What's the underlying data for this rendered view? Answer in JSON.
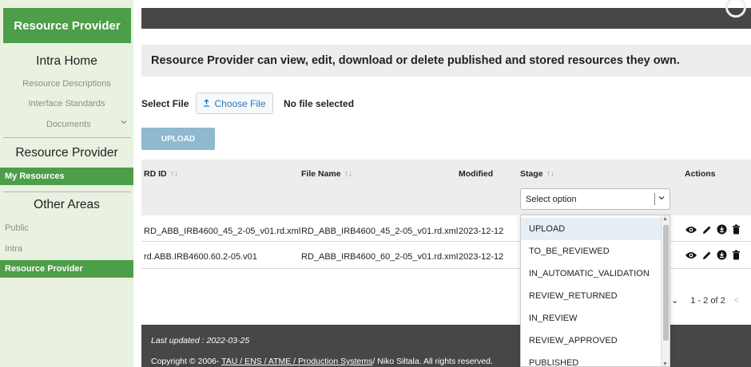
{
  "sidebar": {
    "brand": "Resource Provider",
    "sections": [
      {
        "title": "Intra Home"
      },
      {
        "title": "Resource Provider"
      },
      {
        "title": "Other Areas"
      }
    ],
    "intra_links": [
      "Resource Descriptions",
      "Interface Standards",
      "Documents"
    ],
    "active_my_resources": "My Resources",
    "other_links": [
      "Public",
      "Intra"
    ],
    "active_area": "Resource Provider"
  },
  "banner": "Resource Provider can view, edit, download or delete published and stored resources they own.",
  "upload_form": {
    "select_label": "Select File",
    "choose_label": "Choose File",
    "no_file": "No file selected",
    "upload_label": "UPLOAD"
  },
  "table": {
    "headers": [
      "RD ID",
      "File Name",
      "Modified",
      "Stage",
      "Actions"
    ],
    "stage_filter_placeholder": "Select option",
    "rows": [
      {
        "rd_id": "RD_ABB_IRB4600_45_2-05_v01.rd.xml",
        "file_name": "RD_ABB_IRB4600_45_2-05_v01.rd.xml",
        "modified": "2023-12-12"
      },
      {
        "rd_id": "rd.ABB.IRB4600.60.2-05.v01",
        "file_name": "RD_ABB_IRB4600_60_2-05_v01.rd.xml",
        "modified": "2023-12-12"
      }
    ]
  },
  "stage_options": [
    "UPLOAD",
    "TO_BE_REVIEWED",
    "IN_AUTOMATIC_VALIDATION",
    "REVIEW_RETURNED",
    "IN_REVIEW",
    "REVIEW_APPROVED",
    "PUBLISHED"
  ],
  "pagination": {
    "range": "1 - 2 of 2"
  },
  "footer": {
    "last_updated": "Last updated : 2022-03-25",
    "copyright_prefix": "Copyright © 2006- ",
    "copyright_link": "TAU / ENS / ATME / Production Systems",
    "copyright_suffix": "/ Niko Siltala. All rights reserved."
  },
  "colors": {
    "brand_green": "#4d9e48",
    "sidebar_bg": "#e9f1e1",
    "dark_bar": "#474747",
    "upload_btn": "#8fb9cf"
  }
}
